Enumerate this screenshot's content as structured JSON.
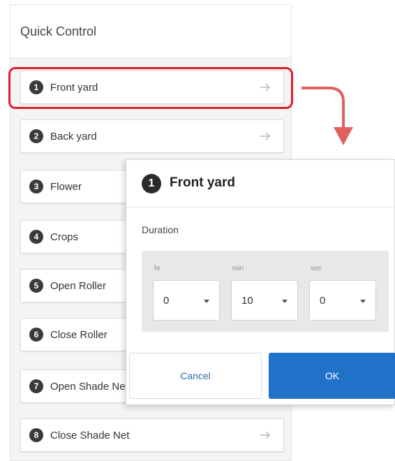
{
  "panel": {
    "title": "Quick Control",
    "items": [
      {
        "number": "1",
        "label": "Front yard"
      },
      {
        "number": "2",
        "label": "Back yard"
      },
      {
        "number": "3",
        "label": "Flower"
      },
      {
        "number": "4",
        "label": "Crops"
      },
      {
        "number": "5",
        "label": "Open Roller"
      },
      {
        "number": "6",
        "label": "Close Roller"
      },
      {
        "number": "7",
        "label": "Open Shade Net"
      },
      {
        "number": "8",
        "label": "Close Shade Net"
      }
    ],
    "selected_index": 0
  },
  "dialog": {
    "number": "1",
    "title": "Front yard",
    "duration_label": "Duration",
    "fields": [
      {
        "unit": "hr",
        "value": "0"
      },
      {
        "unit": "min",
        "value": "10"
      },
      {
        "unit": "sec",
        "value": "0"
      }
    ],
    "cancel_label": "Cancel",
    "ok_label": "OK"
  },
  "colors": {
    "highlight": "#e0202a",
    "connector": "#e06060",
    "primary": "#1f72c8"
  },
  "icons": {
    "item_arrow": "arrow-right-icon",
    "connector": "curved-arrow-down-icon",
    "select_caret": "caret-down-icon"
  }
}
